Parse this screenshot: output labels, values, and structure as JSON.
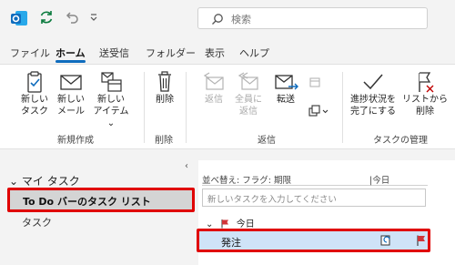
{
  "titlebar": {
    "search_placeholder": "検索",
    "icons": [
      "outlook-logo-icon",
      "sync-icon",
      "undo-icon",
      "customize-toolbar-icon"
    ]
  },
  "menu": {
    "tabs": [
      "ファイル",
      "ホーム",
      "送受信",
      "フォルダー",
      "表示",
      "ヘルプ"
    ],
    "active": "ホーム"
  },
  "ribbon": {
    "groups": {
      "new": "新規作成",
      "delete": "削除",
      "respond": "返信",
      "manage": "タスクの管理"
    },
    "buttons": {
      "new_task": "新しい\nタスク",
      "new_mail": "新しい\nメール",
      "new_items": "新しい\nアイテム ⌄",
      "delete": "削除",
      "reply": "返信",
      "reply_all": "全員に\n返信",
      "forward": "転送",
      "mark_complete": "進捗状況を\n完了にする",
      "remove_from_list": "リストから\n削除"
    }
  },
  "folders": {
    "header": "マイ タスク",
    "items": [
      "To Do バーのタスク リスト",
      "タスク"
    ]
  },
  "tasklist": {
    "sort_label": "並べ替え: フラグ: 期限",
    "sort_group": "今日",
    "new_task_placeholder": "新しいタスクを入力してください",
    "group_label": "今日",
    "tasks": [
      {
        "subject": "発注",
        "flag": "red"
      }
    ]
  },
  "colors": {
    "accent": "#0f6cbd",
    "highlight_border": "#e00000",
    "selected_row": "#cfe3f7",
    "flag": "#d13438"
  }
}
